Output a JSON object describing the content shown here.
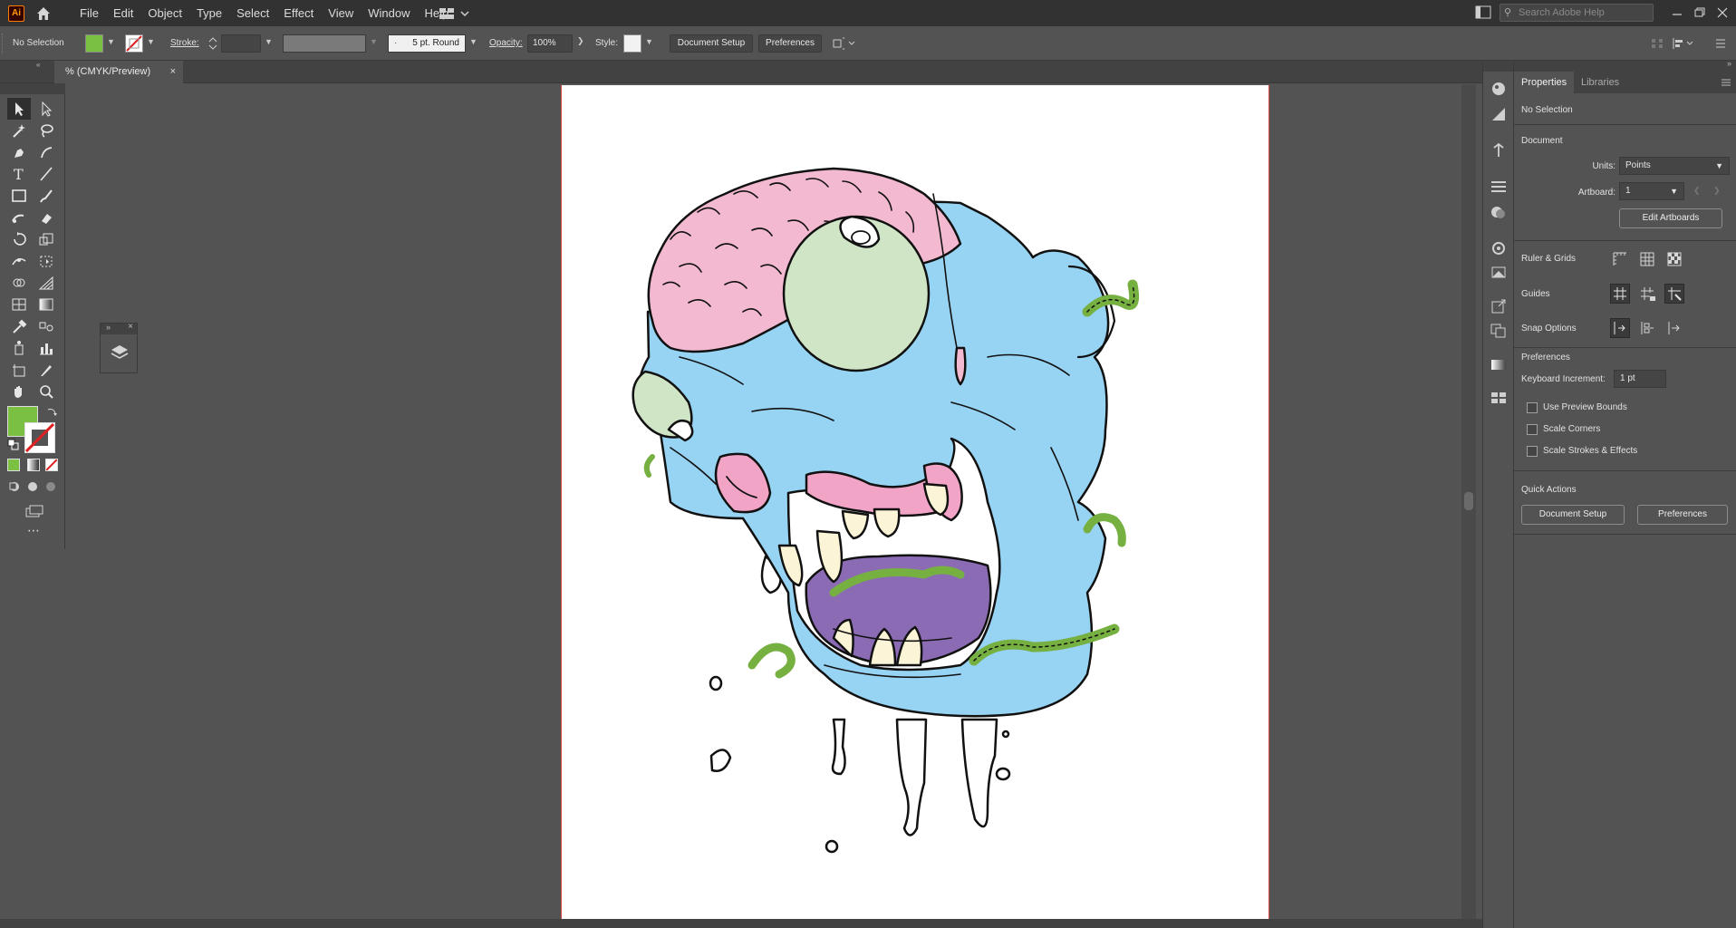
{
  "menubar": {
    "logo": "Ai",
    "items": [
      "File",
      "Edit",
      "Object",
      "Type",
      "Select",
      "Effect",
      "View",
      "Window",
      "Help"
    ],
    "search_placeholder": "Search Adobe Help"
  },
  "controlbar": {
    "selection": "No Selection",
    "fill_color": "#7ac143",
    "stroke_label": "Stroke:",
    "brush": "5 pt. Round",
    "opacity_label": "Opacity:",
    "opacity_value": "100%",
    "style_label": "Style:",
    "document_setup": "Document Setup",
    "preferences": "Preferences"
  },
  "tab": {
    "title": "% (CMYK/Preview)",
    "close": "×"
  },
  "properties": {
    "tab_active": "Properties",
    "tab_inactive": "Libraries",
    "selection": "No Selection",
    "document_title": "Document",
    "units_label": "Units:",
    "units_value": "Points",
    "artboard_label": "Artboard:",
    "artboard_value": "1",
    "edit_artboards": "Edit Artboards",
    "ruler_grids": "Ruler & Grids",
    "guides": "Guides",
    "snap_options": "Snap Options",
    "preferences_title": "Preferences",
    "keyboard_increment_label": "Keyboard Increment:",
    "keyboard_increment_value": "1 pt",
    "use_preview_bounds": "Use Preview Bounds",
    "scale_corners": "Scale Corners",
    "scale_strokes": "Scale Strokes & Effects",
    "quick_actions": "Quick Actions",
    "qa_document_setup": "Document Setup",
    "qa_preferences": "Preferences"
  },
  "colors": {
    "fill": "#7ac143",
    "artboard_border": "#d94a4a",
    "skin": "#97d3f2",
    "brain": "#f3b9d1",
    "eye": "#cfe5c6",
    "gum": "#f2a4c6",
    "tongue": "#8c6bb5",
    "worm": "#76b041",
    "tooth": "#fbf4d6"
  }
}
